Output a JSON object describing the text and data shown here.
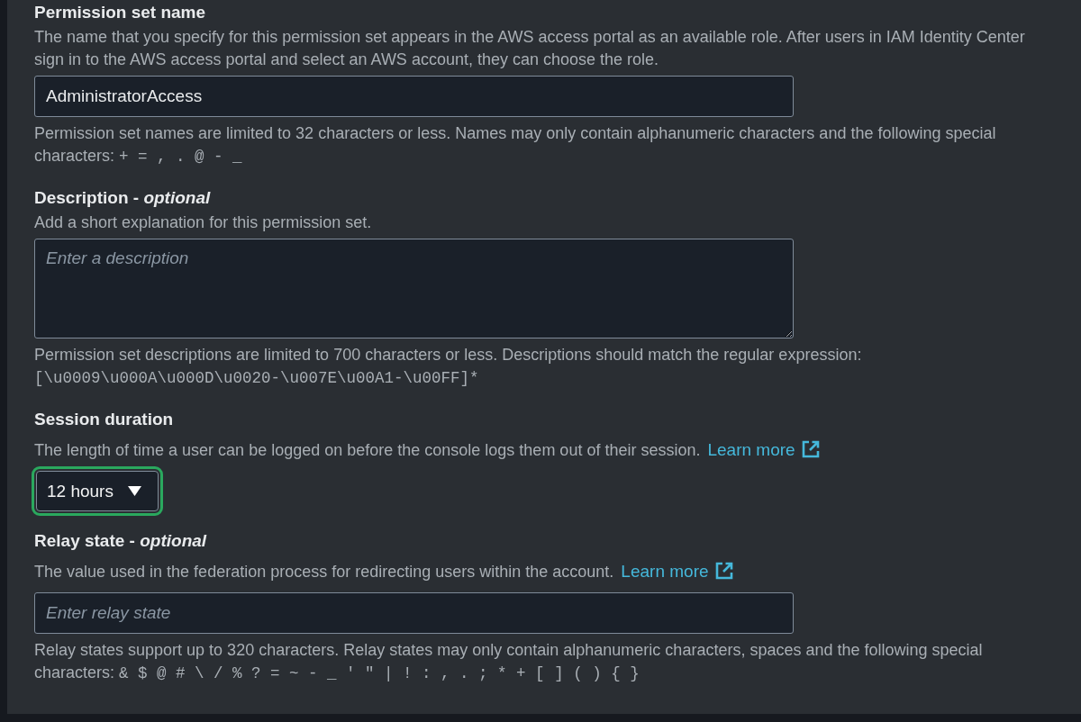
{
  "sections": [
    {
      "kind": "text",
      "label": "Permission set name",
      "description": "The name that you specify for this permission set appears in the AWS access portal as an available role. After users in IAM Identity Center sign in to the AWS access portal and select an AWS account, they can choose the role.",
      "value": "AdministratorAccess",
      "constraint": {
        "text": "Permission set names are limited to 32 characters or less. Names may only contain alphanumeric characters and the following special characters:",
        "code": "+ = , . @ - _"
      }
    },
    {
      "kind": "textarea",
      "label": "Description - *optional*",
      "description": "Add a short explanation for this permission set.",
      "placeholder": "Enter a description",
      "constraint": {
        "text": "Permission set descriptions are limited to 700 characters or less. Descriptions should match the regular expression:",
        "code": "[\\u0009\\u000A\\u000D\\u0020-\\u007E\\u00A1-\\u00FF]*"
      }
    },
    {
      "kind": "select",
      "label": "Session duration",
      "description": "The length of time a user can be logged on before the console logs them out of their session.",
      "link": "Learn more",
      "value": "12 hours",
      "focused": true
    },
    {
      "kind": "text",
      "label": "Relay state - *optional*",
      "description": "The value used in the federation process for redirecting users within the account.",
      "link": "Learn more",
      "placeholder": "Enter relay state",
      "constraint": {
        "text": "Relay states support up to 320 characters. Relay states may only contain alphanumeric characters, spaces and the following special characters:",
        "code": "& $ @ # \\ / % ? = ~ - _ ' \" | ! : , . ; * + [ ] ( ) { }"
      }
    }
  ]
}
